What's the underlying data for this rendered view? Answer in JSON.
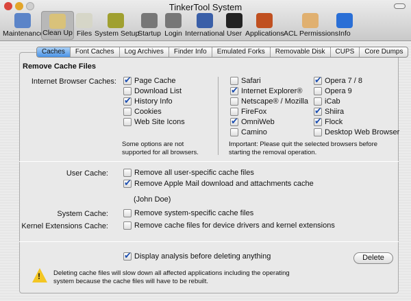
{
  "window": {
    "title": "TinkerTool System"
  },
  "toolbar": [
    {
      "label": "Maintenance",
      "icon": "clipboard-icon",
      "color": "#5b84c8"
    },
    {
      "label": "Clean Up",
      "icon": "broom-icon",
      "color": "#d9c27a",
      "selected": true
    },
    {
      "label": "Files",
      "icon": "files-icon",
      "color": "#d6d6c8"
    },
    {
      "label": "System Setup",
      "icon": "hard-hat-icon",
      "color": "#a0a030"
    },
    {
      "label": "Startup",
      "icon": "power-icon",
      "color": "#777777"
    },
    {
      "label": "Login",
      "icon": "home-icon",
      "color": "#777777"
    },
    {
      "label": "International",
      "icon": "un-flag-icon",
      "color": "#3a5fa8"
    },
    {
      "label": "User",
      "icon": "user-silhouette-icon",
      "color": "#222222"
    },
    {
      "label": "Applications",
      "icon": "applications-icon",
      "color": "#c05020"
    },
    {
      "label": "ACL Permissions",
      "icon": "padlock-icon",
      "color": "#e0b070"
    },
    {
      "label": "Info",
      "icon": "info-icon",
      "color": "#2a6fd6"
    }
  ],
  "tabs": [
    "Caches",
    "Font Caches",
    "Log Archives",
    "Finder Info",
    "Emulated Forks",
    "Removable Disk",
    "CUPS",
    "Core Dumps"
  ],
  "section_title": "Remove Cache Files",
  "browser": {
    "label": "Internet Browser Caches:",
    "items": [
      {
        "label": "Page Cache",
        "checked": true
      },
      {
        "label": "Download List",
        "checked": false
      },
      {
        "label": "History Info",
        "checked": true
      },
      {
        "label": "Cookies",
        "checked": false
      },
      {
        "label": "Web Site Icons",
        "checked": false
      }
    ],
    "note": "Some options are not supported for all browsers.",
    "browsers_col1": [
      {
        "label": "Safari",
        "checked": false
      },
      {
        "label": "Internet Explorer®",
        "checked": true
      },
      {
        "label": "Netscape® / Mozilla",
        "checked": false
      },
      {
        "label": "FireFox",
        "checked": false
      },
      {
        "label": "OmniWeb",
        "checked": true
      },
      {
        "label": "Camino",
        "checked": false
      }
    ],
    "browsers_col2": [
      {
        "label": "Opera 7 / 8",
        "checked": true
      },
      {
        "label": "Opera 9",
        "checked": false
      },
      {
        "label": "iCab",
        "checked": false
      },
      {
        "label": "Shiira",
        "checked": true
      },
      {
        "label": "Flock",
        "checked": true
      },
      {
        "label": "Desktop Web Browser",
        "checked": false
      }
    ],
    "important": "Important: Please quit the selected browsers before starting the removal operation."
  },
  "user_cache": {
    "label": "User Cache:",
    "items": [
      {
        "label": "Remove all user-specific cache files",
        "checked": false
      },
      {
        "label": "Remove Apple Mail download and attachments cache",
        "checked": true
      }
    ],
    "user": "(John Doe)"
  },
  "system_cache": {
    "label": "System Cache:",
    "item": {
      "label": "Remove system-specific cache files",
      "checked": false
    }
  },
  "kernel_cache": {
    "label": "Kernel Extensions Cache:",
    "item": {
      "label": "Remove cache files for device drivers and kernel extensions",
      "checked": false
    }
  },
  "display_analysis": {
    "label": "Display analysis before deleting anything",
    "checked": true
  },
  "delete_label": "Delete",
  "warning": "Deleting cache files will slow down all affected applications including the operating system because the cache files will have to be rebuilt."
}
